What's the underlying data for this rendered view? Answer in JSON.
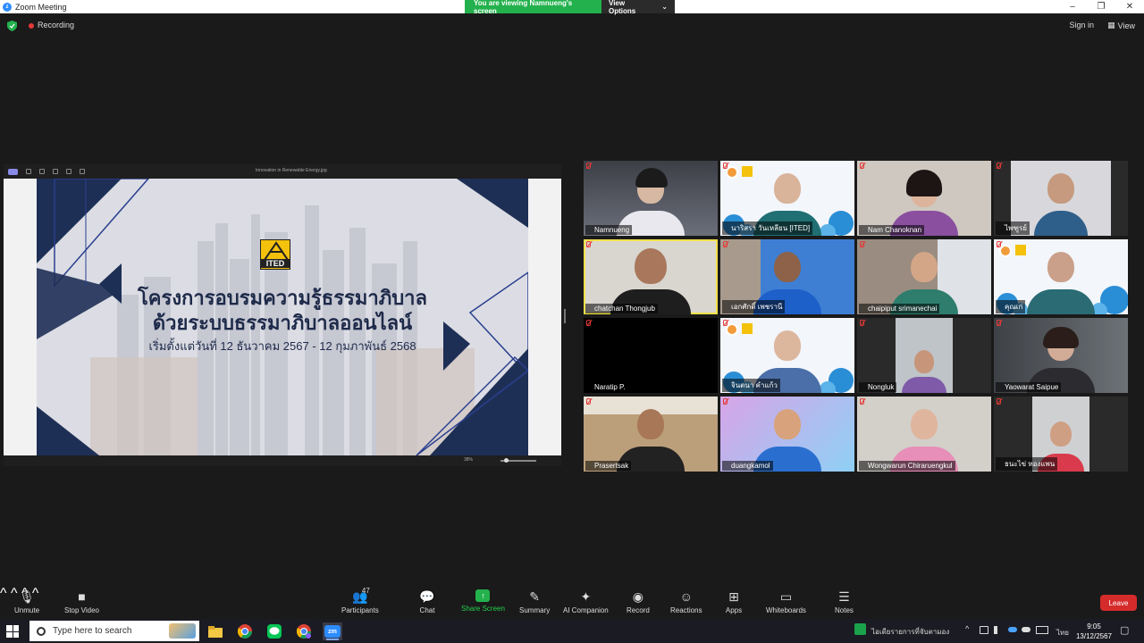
{
  "window": {
    "title": "Zoom Meeting",
    "logo_glyph": "z",
    "minimize_glyph": "–",
    "maximize_glyph": "❐",
    "close_glyph": "✕"
  },
  "banner": {
    "viewing_text": "You are viewing Namnueng's screen",
    "options_label": "View Options",
    "options_caret": "⌄"
  },
  "status": {
    "recording_label": "Recording",
    "sign_in_label": "Sign in",
    "view_label": "View",
    "view_glyph": "▦"
  },
  "shared_screen": {
    "viewer_title": "Innovation in Renewable Energy.jpg",
    "zoom_level": "38%",
    "slide": {
      "logo_text": "ITED",
      "heading_line1": "โครงการอบรมความรู้ธรรมาภิบาล",
      "heading_line2": "ด้วยระบบธรรมาภิบาลออนไลน์",
      "date_line": "เริ่มตั้งแต่วันที่ 12 ธันวาคม 2567 - 12 กุมภาพันธ์ 2568"
    }
  },
  "participants": [
    {
      "name": "Namnueng"
    },
    {
      "name": "นาริสรา วันเหลียน [ITED]"
    },
    {
      "name": "Nam Chanoknan"
    },
    {
      "name": "ไพฑูรย์"
    },
    {
      "name": "chatchan Thongjub"
    },
    {
      "name": "เอกศักดิ์ เพชรานี"
    },
    {
      "name": "chaipiput srimanechai"
    },
    {
      "name": "คุณเก่"
    },
    {
      "name": "Naratip P."
    },
    {
      "name": "จินตนา คำแก้ว"
    },
    {
      "name": "Nongluk"
    },
    {
      "name": "Yaowarat Saipue"
    },
    {
      "name": "Prasertsak"
    },
    {
      "name": "duangkamol"
    },
    {
      "name": "Wongwarun Chiraruengkul"
    },
    {
      "name": "ธนะไข่ ทองแพน"
    }
  ],
  "toolbar": {
    "unmute": "Unmute",
    "stop_video": "Stop Video",
    "participants": "Participants",
    "participants_count": "47",
    "chat": "Chat",
    "share_screen": "Share Screen",
    "summary": "Summary",
    "ai_companion": "AI Companion",
    "record": "Record",
    "reactions": "Reactions",
    "apps": "Apps",
    "whiteboards": "Whiteboards",
    "notes": "Notes",
    "leave": "Leave",
    "caret_glyph": "^",
    "mic_glyph": "🎙",
    "video_glyph": "■",
    "participants_glyph": "👥",
    "chat_glyph": "💬",
    "share_glyph": "↑",
    "summary_glyph": "✎",
    "ai_glyph": "✦",
    "record_glyph": "◉",
    "reactions_glyph": "☺",
    "apps_glyph": "⊞",
    "whiteboards_glyph": "▭",
    "notes_glyph": "☰"
  },
  "taskbar": {
    "search_placeholder": "Type here to search",
    "zoom_app_label": "zm",
    "notification_text": "ไอเดียรายการที่จับตามอง",
    "tray_chevron": "^",
    "language": "ไทย",
    "time": "9:05",
    "date": "13/12/2567",
    "notification_glyph": "▢"
  },
  "colors": {
    "share_green": "#23b14d",
    "leave_red": "#d52b2b",
    "active_speaker": "#f2e14a",
    "slide_navy": "#1e2a4a"
  }
}
